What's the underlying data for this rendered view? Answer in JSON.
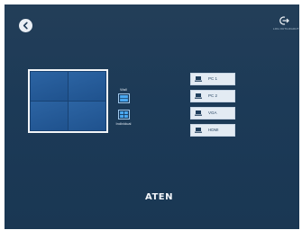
{
  "header": {
    "logout_label": "LOG OUT/LOGOUT"
  },
  "wall": {
    "preview_cells": 4
  },
  "modes": {
    "wall_label": "Wall",
    "individual_label": "Individual"
  },
  "sources": [
    {
      "label": "PC 1"
    },
    {
      "label": "PC 2"
    },
    {
      "label": "VGA"
    },
    {
      "label": "HDMI"
    }
  ],
  "brand": {
    "logo_text": "ATEN"
  },
  "colors": {
    "background": "#1c3a57",
    "wall_tile": "#2c64a3",
    "source_button": "#e3ebf3",
    "accent_icon": "#4aa8f0"
  }
}
